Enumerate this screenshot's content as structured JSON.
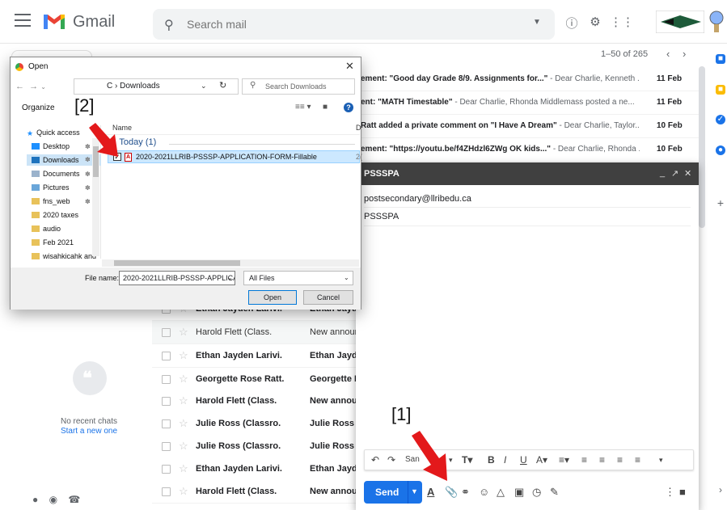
{
  "header": {
    "app_name": "Gmail",
    "search_placeholder": "Search mail",
    "icons": [
      "menu-icon",
      "help-icon",
      "settings-icon",
      "apps-icon"
    ]
  },
  "toolbar": {
    "page_count": "1–50 of 265"
  },
  "top_rows": [
    {
      "subject": "ement: \"Good day Grade 8/9. Assignments for...\"",
      "snippet": " - Dear Charlie, Kenneth ...",
      "date": "11 Feb"
    },
    {
      "subject": "ent: \"MATH Timestable\"",
      "snippet": " - Dear Charlie, Rhonda Middlemass posted a ne...",
      "date": "11 Feb"
    },
    {
      "subject": "Ratt added a private comment on \"I Have A Dream\"",
      "snippet": " - Dear Charlie, Taylor...",
      "date": "10 Feb"
    },
    {
      "subject": "ement: \"https://youtu.be/f4ZHdzl6ZWg OK kids...\"",
      "snippet": " - Dear Charlie, Rhonda ...",
      "date": "10 Feb"
    }
  ],
  "email_rows": [
    {
      "sender": "Ethan Jayden Larivi.",
      "subject": "Ethan Jayde",
      "unread": true
    },
    {
      "sender": "Harold Flett (Class.",
      "subject": "New annour",
      "unread": false
    },
    {
      "sender": "Ethan Jayden Larivi.",
      "subject": "Ethan Jayde",
      "unread": true
    },
    {
      "sender": "Georgette Rose Ratt.",
      "subject": "Georgette R",
      "unread": true
    },
    {
      "sender": "Harold Flett (Class.",
      "subject": "New annour",
      "unread": true
    },
    {
      "sender": "Julie Ross (Classro.",
      "subject": "Julie Ross c",
      "unread": true
    },
    {
      "sender": "Julie Ross (Classro.",
      "subject": "Julie Ross c",
      "unread": true
    },
    {
      "sender": "Ethan Jayden Larivi.",
      "subject": "Ethan Jayde",
      "unread": true
    },
    {
      "sender": "Harold Flett (Class.",
      "subject": "New annour",
      "unread": true
    }
  ],
  "chat": {
    "no_chats": "No recent chats",
    "start_new": "Start a new one"
  },
  "compose": {
    "title": "PSSSPA",
    "to": "postsecondary@llribedu.ca",
    "subject": "PSSSPA",
    "send_label": "Send",
    "font_label": "San"
  },
  "annotations": {
    "label_1": "[1]",
    "label_2": "[2]",
    "arrow_color": "#e3191b"
  },
  "dialog": {
    "title": "Open",
    "address": "C  ›  Downloads",
    "search_placeholder": "Search Downloads",
    "organize": "Organize",
    "col_name": "Name",
    "col_d": "D",
    "group": "Today (1)",
    "tree": [
      "Quick access",
      "Desktop",
      "Downloads",
      "Documents",
      "Pictures",
      "fns_web",
      "2020 taxes",
      "audio",
      "Feb 2021",
      "wisahkicahk and"
    ],
    "file": "2020-2021LLRIB-PSSSP-APPLICATION-FORM-Fillable",
    "file_d": "2(",
    "file_name_label": "File name:",
    "file_name_value": "2020-2021LLRIB-PSSSP-APPLICATI",
    "file_type": "All Files",
    "open_label": "Open",
    "cancel_label": "Cancel"
  },
  "colors": {
    "gmail_red": "#ea4335",
    "send_blue": "#1a73e8",
    "compose_header": "#404040",
    "selection": "#cce8ff"
  }
}
